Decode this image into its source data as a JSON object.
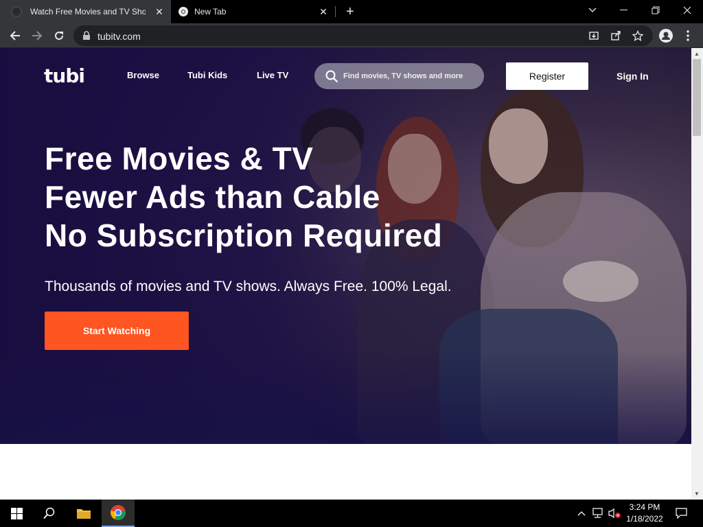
{
  "browser": {
    "tabs": [
      {
        "title": "Watch Free Movies and TV Shows",
        "active": true
      },
      {
        "title": "New Tab",
        "active": false
      }
    ],
    "url": "tubitv.com"
  },
  "site": {
    "logo": "tubi",
    "nav": [
      "Browse",
      "Tubi Kids",
      "Live TV"
    ],
    "search_placeholder": "Find movies, TV shows and more",
    "register": "Register",
    "sign_in": "Sign In"
  },
  "hero": {
    "headline": [
      "Free Movies & TV",
      "Fewer Ads than Cable",
      "No Subscription Required"
    ],
    "subline": "Thousands of movies and TV shows. Always Free. 100% Legal.",
    "cta": "Start Watching"
  },
  "colors": {
    "accent": "#ff5521",
    "hero_bg": "#1c1538",
    "chrome_dark": "#35363a"
  },
  "taskbar": {
    "time": "3:24 PM",
    "date": "1/18/2022"
  }
}
